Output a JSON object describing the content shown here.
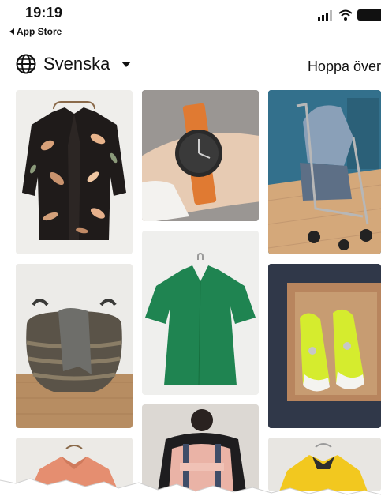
{
  "status_bar": {
    "time": "19:19",
    "back_label": "App Store"
  },
  "header": {
    "language_label": "Svenska",
    "skip_label": "Hoppa över"
  },
  "icons": {
    "language": "globe-icon",
    "caret": "caret-down-icon",
    "back": "back-arrow-icon",
    "signal": "cellular-signal-icon",
    "wifi": "wifi-icon",
    "battery": "battery-icon"
  },
  "tiles": [
    {
      "item": "floral-blazer"
    },
    {
      "item": "wrist-watch"
    },
    {
      "item": "baby-stroller"
    },
    {
      "item": "woven-basket"
    },
    {
      "item": "green-dress"
    },
    {
      "item": "neon-sneakers"
    },
    {
      "item": "pink-backpack"
    },
    {
      "item": "coral-shirt"
    },
    {
      "item": "yellow-raincoat"
    }
  ],
  "colors": {
    "background": "#ffffff",
    "text": "#111111",
    "tile_light": "#eeeeec"
  }
}
